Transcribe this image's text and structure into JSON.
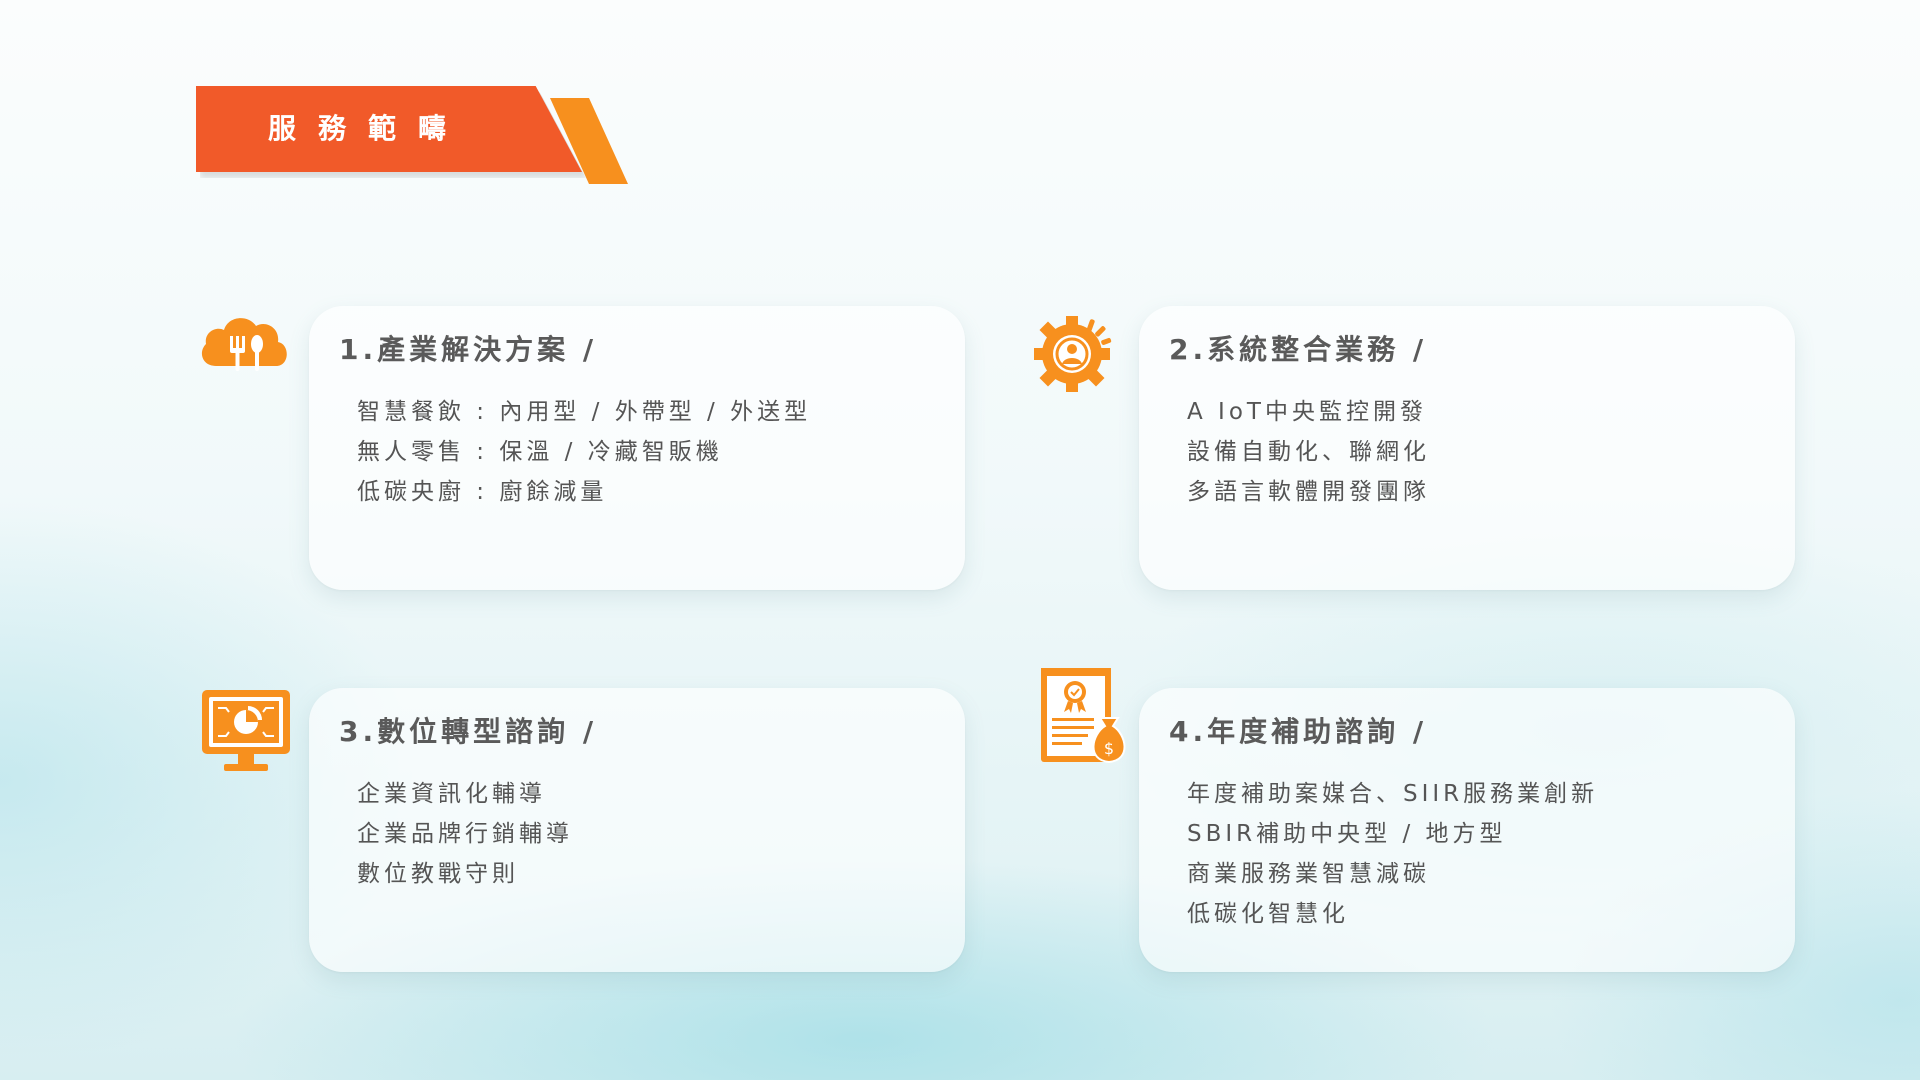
{
  "banner": {
    "title": "服務範疇"
  },
  "colors": {
    "banner_primary": "#f15a29",
    "banner_accent": "#f7901e",
    "icon_orange": "#f7901e"
  },
  "services": [
    {
      "title": "1.產業解決方案 /",
      "icon": "cloud-utensils-icon",
      "items": [
        "智慧餐飲 : 內用型 / 外帶型 / 外送型",
        "無人零售 : 保溫 / 冷藏智販機",
        "低碳央廚 : 廚餘減量"
      ]
    },
    {
      "title": "2.系統整合業務 /",
      "icon": "gear-user-icon",
      "items": [
        "A IoT中央監控開發",
        "設備自動化、聯網化",
        "多語言軟體開發團隊"
      ]
    },
    {
      "title": "3.數位轉型諮詢 /",
      "icon": "monitor-chart-icon",
      "items": [
        "企業資訊化輔導",
        "企業品牌行銷輔導",
        "數位教戰守則"
      ]
    },
    {
      "title": "4.年度補助諮詢 /",
      "icon": "certificate-money-icon",
      "items": [
        "年度補助案媒合、SIIR服務業創新",
        "SBIR補助中央型 / 地方型",
        "商業服務業智慧減碳",
        "低碳化智慧化"
      ]
    }
  ]
}
